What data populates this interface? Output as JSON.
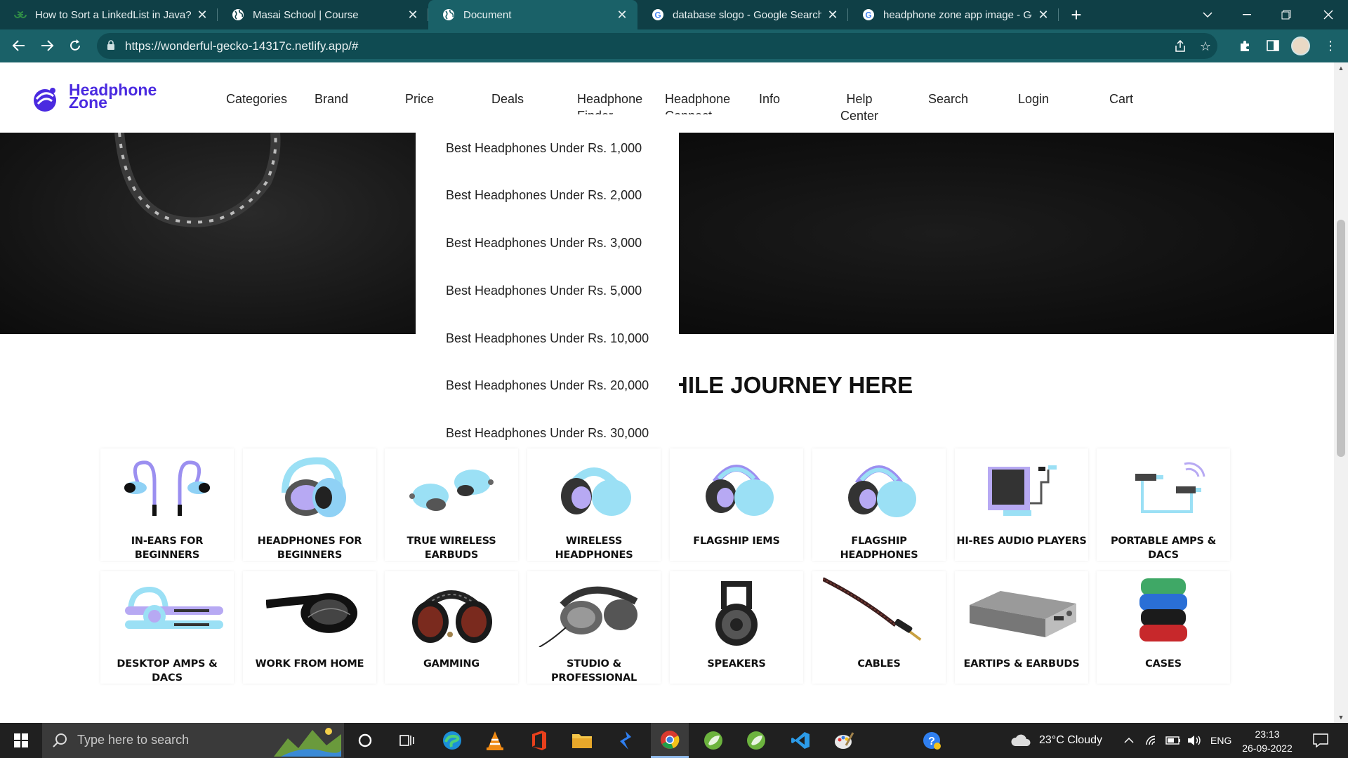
{
  "browser": {
    "tabs": [
      {
        "title": "How to Sort a LinkedList in Java?",
        "favicon": "geeksforgeeks-icon"
      },
      {
        "title": "Masai School | Course",
        "favicon": "globe-icon"
      },
      {
        "title": "Document",
        "favicon": "globe-icon"
      },
      {
        "title": "database slogo - Google Search",
        "favicon": "google-icon"
      },
      {
        "title": "headphone zone app image - Google Search",
        "favicon": "google-icon"
      }
    ],
    "active_tab_index": 2,
    "url": "https://wonderful-gecko-14317c.netlify.app/#"
  },
  "site": {
    "logo": {
      "line1": "Headphone",
      "line2": "Zone"
    },
    "brand_color": "#4a2ae0",
    "nav": [
      {
        "line1": "Categories",
        "line2": ""
      },
      {
        "line1": "Brand",
        "line2": ""
      },
      {
        "line1": "Price",
        "line2": ""
      },
      {
        "line1": "Deals",
        "line2": ""
      },
      {
        "line1": "Headphone",
        "line2": "Finder"
      },
      {
        "line1": "Headphone",
        "line2": "Connect"
      },
      {
        "line1": "Info",
        "line2": ""
      },
      {
        "line1": "Help",
        "line2": "Center"
      },
      {
        "line1": "Search",
        "line2": ""
      },
      {
        "line1": "Login",
        "line2": ""
      },
      {
        "line1": "Cart",
        "line2": ""
      }
    ],
    "price_dropdown": [
      "Best Headphones Under Rs. 1,000",
      "Best Headphones Under Rs. 2,000",
      "Best Headphones Under Rs. 3,000",
      "Best Headphones Under Rs. 5,000",
      "Best Headphones Under Rs. 10,000",
      "Best Headphones Under Rs. 20,000",
      "Best Headphones Under Rs. 30,000"
    ],
    "section_heading_visible": "HILE JOURNEY HERE",
    "categories": [
      {
        "label": "IN-EARS FOR BEGINNERS",
        "icon": "in-ear-earphones-icon"
      },
      {
        "label": "HEADPHONES FOR BEGINNERS",
        "icon": "headphones-icon"
      },
      {
        "label": "TRUE WIRELESS EARBUDS",
        "icon": "wireless-earbuds-icon"
      },
      {
        "label": "WIRELESS HEADPHONES",
        "icon": "wireless-headphones-icon"
      },
      {
        "label": "FLAGSHIP IEMS",
        "icon": "flagship-iem-icon"
      },
      {
        "label": "FLAGSHIP HEADPHONES",
        "icon": "flagship-headphones-icon"
      },
      {
        "label": "HI-RES AUDIO PLAYERS",
        "icon": "audio-player-icon"
      },
      {
        "label": "PORTABLE AMPS & DACS",
        "icon": "portable-dac-icon"
      },
      {
        "label": "DESKTOP AMPS & DACS",
        "icon": "desktop-dac-icon"
      },
      {
        "label": "WORK FROM HOME",
        "icon": "headset-icon"
      },
      {
        "label": "GAMMING",
        "icon": "gaming-headphones-icon"
      },
      {
        "label": "STUDIO & PROFESSIONAL",
        "icon": "studio-headphones-icon"
      },
      {
        "label": "SPEAKERS",
        "icon": "speaker-icon"
      },
      {
        "label": "CABLES",
        "icon": "cable-icon"
      },
      {
        "label": "EARTIPS & EARBUDS",
        "icon": "amplifier-icon"
      },
      {
        "label": "CASES",
        "icon": "cases-icon"
      }
    ]
  },
  "taskbar": {
    "search_placeholder": "Type here to search",
    "weather": "23°C  Cloudy",
    "language": "ENG",
    "time": "23:13",
    "date": "26-09-2022"
  }
}
